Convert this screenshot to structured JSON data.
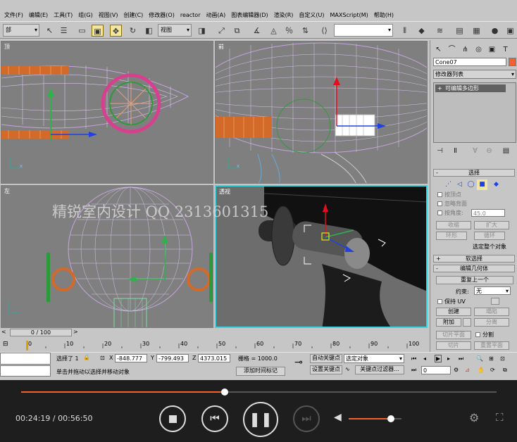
{
  "menu": [
    "文件(F)",
    "编辑(E)",
    "工具(T)",
    "组(G)",
    "视图(V)",
    "创建(C)",
    "修改器(O)",
    "reactor",
    "动画(A)",
    "图表编辑器(D)",
    "渲染(R)",
    "自定义(U)",
    "MAXScript(M)",
    "帮助(H)"
  ],
  "toolbar": {
    "selection_filter": "部",
    "ref_coord": "视图",
    "named_selection": ""
  },
  "viewports": {
    "top_left": "顶",
    "top_right": "前",
    "bottom_left": "左",
    "bottom_right": "透视"
  },
  "watermark": "精锐室内设计 QQ 2313601315",
  "command_panel": {
    "object_name": "Cone07",
    "modifier_list": "修改器列表",
    "stack_item": "可编辑多边形",
    "selection": {
      "header": "选择",
      "by_vertex": "按顶点",
      "ignore_backfacing": "忽略背面",
      "by_angle": "按角度:",
      "angle_value": "45.0",
      "shrink": "收缩",
      "grow": "扩大",
      "ring": "环形",
      "loop": "循环",
      "whole_object": "选定整个对象"
    },
    "soft_selection": "软选择",
    "edit_geometry": {
      "header": "编辑几何体",
      "repeat_last": "重复上一个",
      "constraints_label": "约束:",
      "constraints_value": "无",
      "preserve_uv": "保持 UV",
      "create": "创建",
      "collapse": "塌陷",
      "attach": "附加",
      "detach": "分离",
      "slice_plane": "切片平面",
      "split": "分割",
      "slice": "切片",
      "reset_plane": "重置平面"
    }
  },
  "timeline": {
    "frame_display": "0 / 100",
    "ticks": [
      "0",
      "10",
      "20",
      "30",
      "40",
      "50",
      "60",
      "70",
      "80",
      "90",
      "100"
    ]
  },
  "status": {
    "selected": "选择了 1",
    "x_label": "X",
    "x": "-848.777",
    "y_label": "Y",
    "y": "-799.493",
    "z_label": "Z",
    "z": "4373.015",
    "grid": "栅格 = 1000.0",
    "prompt": "单击并拖动以选择并移动对象",
    "add_time_tag": "添加时间标记",
    "auto_key": "自动关键点",
    "set_key": "设置关键点",
    "key_mode": "选定对象",
    "key_filters": "关键点过滤器...",
    "frame": "0"
  },
  "player": {
    "elapsed": "00:24:19",
    "total": "00:56:50",
    "sep": " / ",
    "progress": 0.428,
    "volume": 0.8
  },
  "colors": {
    "accent": "#f06030",
    "viewport_bg": "#7f7f7f",
    "active_border": "#33d6e0"
  }
}
